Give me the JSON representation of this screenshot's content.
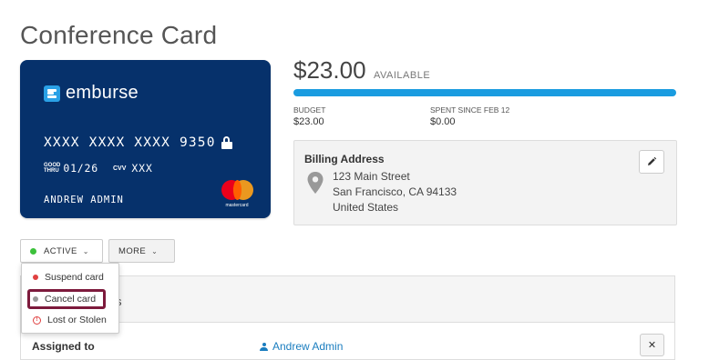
{
  "page": {
    "title": "Conference Card"
  },
  "card": {
    "brand": "emburse",
    "number": "XXXX XXXX XXXX 9350",
    "good_thru_label_1": "GOOD",
    "good_thru_label_2": "THRU",
    "expiry": "01/26",
    "cvv_label": "CVV",
    "cvv": "XXX",
    "holder": "ANDREW ADMIN",
    "network": "mastercard"
  },
  "balance": {
    "amount": "$23.00",
    "available_label": "AVAILABLE",
    "progress_fraction": 1.0,
    "budget_label": "BUDGET",
    "budget_value": "$23.00",
    "spent_label": "SPENT SINCE FEB 12",
    "spent_value": "$0.00"
  },
  "billing": {
    "title": "Billing Address",
    "line1": "123 Main Street",
    "line2": "San Francisco, CA 94133",
    "line3": "United States",
    "edit_icon": "pencil-icon"
  },
  "actions": {
    "status_label": "ACTIVE",
    "status_color": "#3cc13b",
    "more_label": "MORE"
  },
  "dropdown": {
    "items": [
      {
        "label": "Suspend card",
        "icon": "red-dot",
        "color": "#e04040"
      },
      {
        "label": "Cancel card",
        "icon": "gray-dot",
        "color": "#999999"
      },
      {
        "label": "Lost or Stolen",
        "icon": "warning-circle-icon",
        "color": "#e04040"
      }
    ]
  },
  "details": {
    "header_visible_fragment": "s",
    "assigned_label": "Assigned to",
    "assigned_user": "Andrew Admin",
    "remove_symbol": "✕"
  },
  "colors": {
    "card_bg": "#06316b",
    "accent": "#1a9ce0",
    "highlight_border": "#7d1a3c"
  }
}
